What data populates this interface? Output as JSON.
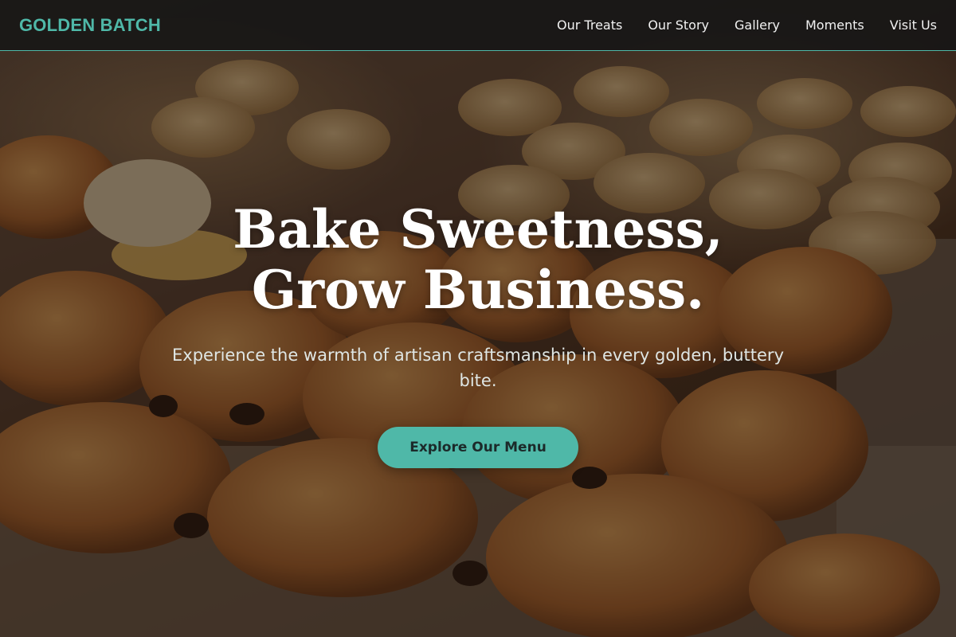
{
  "brand": {
    "name": "GOLDEN BATCH"
  },
  "nav": {
    "items": [
      {
        "label": "Our Treats"
      },
      {
        "label": "Our Story"
      },
      {
        "label": "Gallery"
      },
      {
        "label": "Moments"
      },
      {
        "label": "Visit Us"
      }
    ]
  },
  "hero": {
    "title": "Bake Sweetness, Grow Business.",
    "subtitle": "Experience the warmth of artisan craftsmanship in every golden, buttery bite.",
    "cta_label": "Explore Our Menu",
    "background_image": "pastry-tray-photo"
  },
  "colors": {
    "accent": "#4fb8a8",
    "nav_background": "#161616",
    "title_text": "#ffffff"
  }
}
